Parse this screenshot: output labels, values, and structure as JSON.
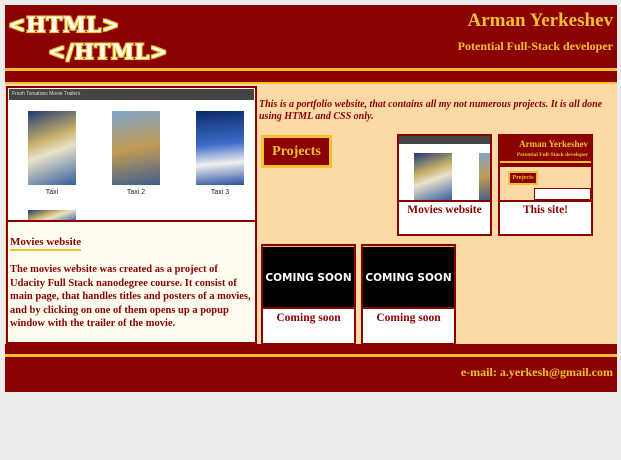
{
  "header": {
    "logo_open": "<HTML>",
    "logo_close": "</HTML>",
    "owner_name": "Arman Yerkeshev",
    "owner_role": "Potential Full-Stack developer"
  },
  "preview": {
    "shot_title": "Fresh Tomatoes Movie Trailers",
    "movies": [
      {
        "title": "Taxi"
      },
      {
        "title": "Taxi 2"
      },
      {
        "title": "Taxi 3"
      }
    ],
    "title": "Movies website",
    "description": "The movies website was created as a project of Udacity Full Stack nanodegree course. It consist of main page, that handles titles and posters of a movies, and by clicking on one of them opens up a popup window with the trailer of the movie."
  },
  "intro": "This is a portfolio website, that contains all my not numerous projects. It is all done using HTML and CSS only.",
  "projects_label": "Projects",
  "projects": [
    {
      "label": "Movies website"
    },
    {
      "label": "This site!"
    },
    {
      "label": "Coming soon",
      "thumb_text": "COMING SOON"
    },
    {
      "label": "Coming soon",
      "thumb_text": "COMING SOON"
    }
  ],
  "mini_site": {
    "name": "Arman Yerkeshev",
    "role": "Potential Full-Stack developer",
    "projects": "Projects"
  },
  "footer": {
    "email": "e-mail: a.yerkesh@gmail.com"
  },
  "colors": {
    "primary": "#8b0000",
    "accent": "#f2c12e",
    "content_bg": "#fcd9a5"
  }
}
